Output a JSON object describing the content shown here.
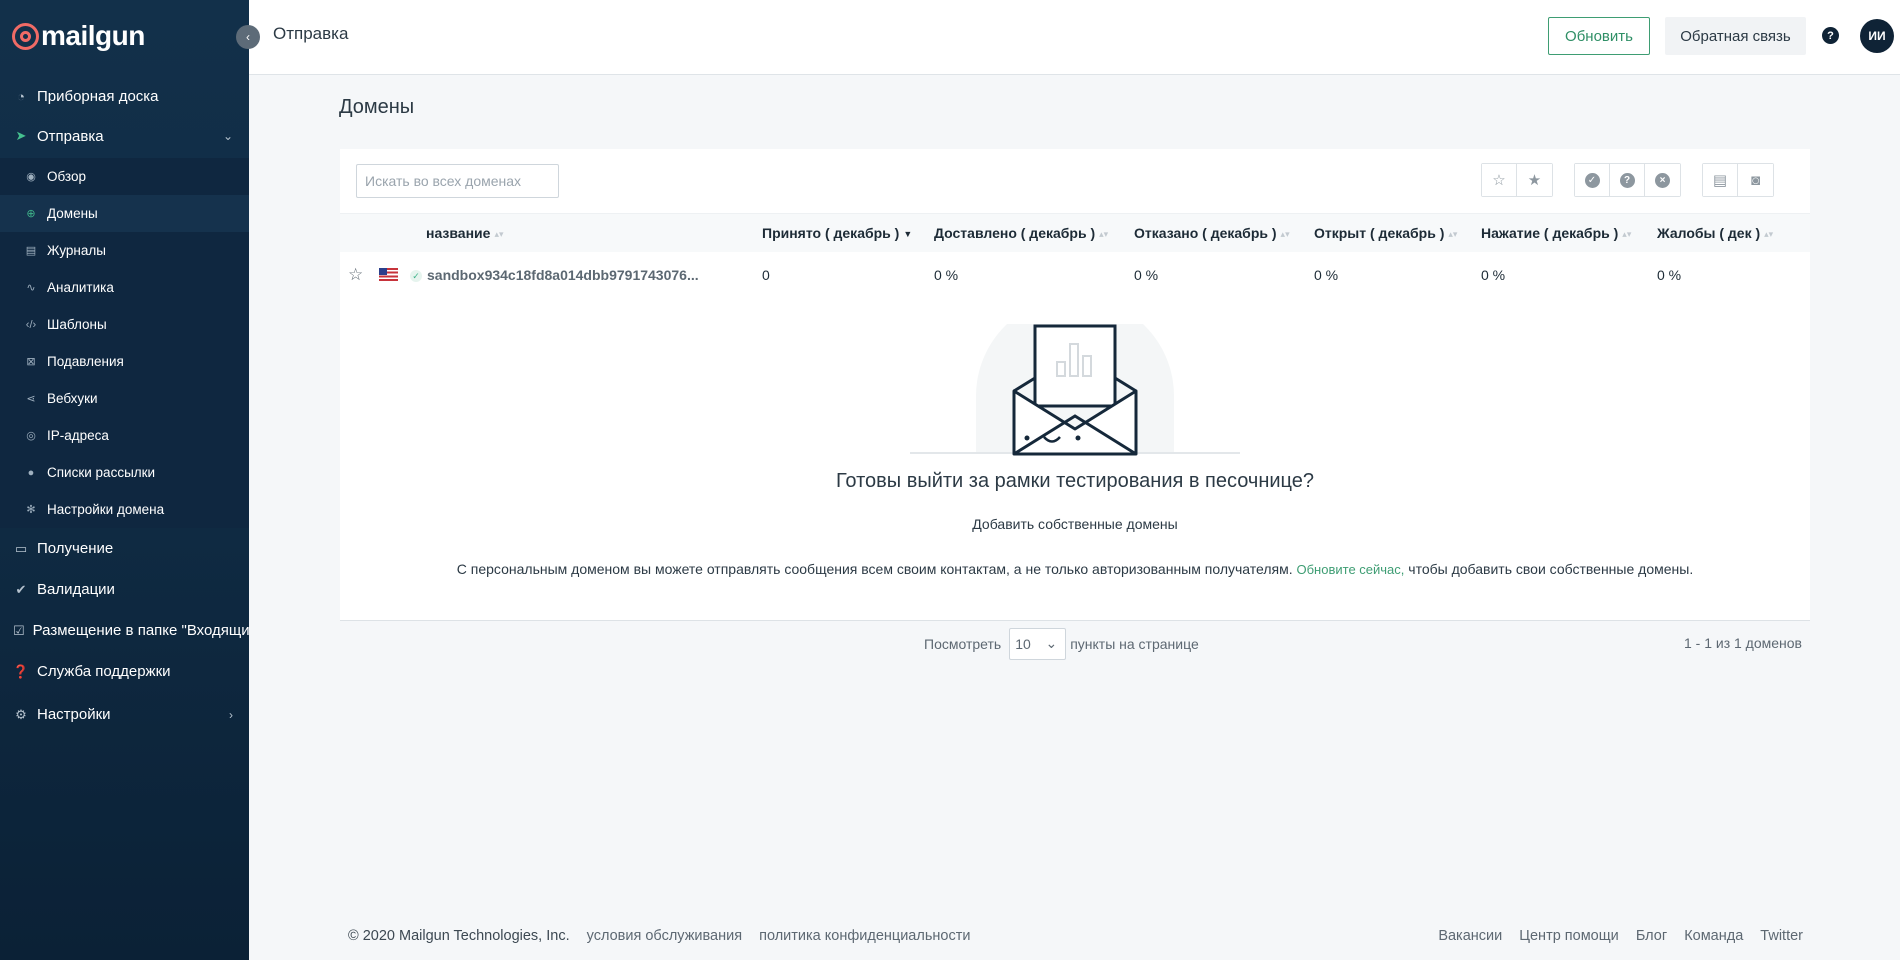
{
  "app": {
    "logo_text": "mailgun"
  },
  "header": {
    "title": "Отправка",
    "refresh_label": "Обновить",
    "feedback_label": "Обратная связь",
    "help_glyph": "?",
    "avatar_initials": "ИИ"
  },
  "sidebar": {
    "top": [
      {
        "label": "Приборная доска",
        "icon": "dashboard-icon"
      },
      {
        "label": "Отправка",
        "icon": "send-icon"
      }
    ],
    "sub": [
      {
        "label": "Обзор",
        "icon": "eye-icon"
      },
      {
        "label": "Домены",
        "icon": "globe-icon"
      },
      {
        "label": "Журналы",
        "icon": "log-icon"
      },
      {
        "label": "Аналитика",
        "icon": "analytics-icon"
      },
      {
        "label": "Шаблоны",
        "icon": "code-icon"
      },
      {
        "label": "Подавления",
        "icon": "suppression-icon"
      },
      {
        "label": "Вебхуки",
        "icon": "share-icon"
      },
      {
        "label": "IP-адреса",
        "icon": "location-icon"
      },
      {
        "label": "Списки рассылки",
        "icon": "user-icon"
      },
      {
        "label": "Настройки домена",
        "icon": "gear-icon"
      }
    ],
    "bottom": [
      {
        "label": "Получение",
        "icon": "inbox-icon"
      },
      {
        "label": "Валидации",
        "icon": "validation-icon"
      },
      {
        "label": "Размещение в папке \"Входящие\"",
        "icon": "checkbox-icon"
      },
      {
        "label": "Служба поддержки",
        "icon": "help-icon"
      },
      {
        "label": "Настройки",
        "icon": "settings-icon"
      }
    ]
  },
  "main": {
    "page_title": "Домены",
    "search_placeholder": "Искать во всех доменах",
    "columns": [
      "название",
      "Принято ( декабрь )",
      "Доставлено ( декабрь )",
      "Отказано ( декабрь )",
      "Открыт ( декабрь )",
      "Нажатие ( декабрь )",
      "Жалобы ( дек )"
    ],
    "row": {
      "domain": "sandbox934c18fd8a014dbb9791743076...",
      "accepted": "0",
      "delivered": "0 %",
      "rejected": "0 %",
      "opened": "0 %",
      "clicked": "0 %",
      "complaints": "0 %"
    },
    "empty": {
      "title": "Готовы выйти за рамки тестирования в песочнице?",
      "subtitle": "Добавить собственные домены",
      "note_before": "С персональным доменом вы можете отправлять сообщения всем своим контактам, а не только авторизованным получателям.",
      "note_link": "Обновите сейчас,",
      "note_after": "чтобы добавить свои собственные домены."
    },
    "pager": {
      "view_label": "Посмотреть",
      "per_page": "10",
      "per_page_suffix": "пункты на странице",
      "count": "1 - 1 из 1 доменов"
    }
  },
  "footer": {
    "copyright": "© 2020 Mailgun Technologies, Inc.",
    "terms": "условия обслуживания",
    "privacy": "политика конфиденциальности",
    "links": [
      "Вакансии",
      "Центр помощи",
      "Блог",
      "Команда",
      "Twitter"
    ]
  },
  "colors": {
    "sidebar": "#12304a",
    "accent_green": "#3e9d73",
    "brand_red": "#f06b66"
  }
}
